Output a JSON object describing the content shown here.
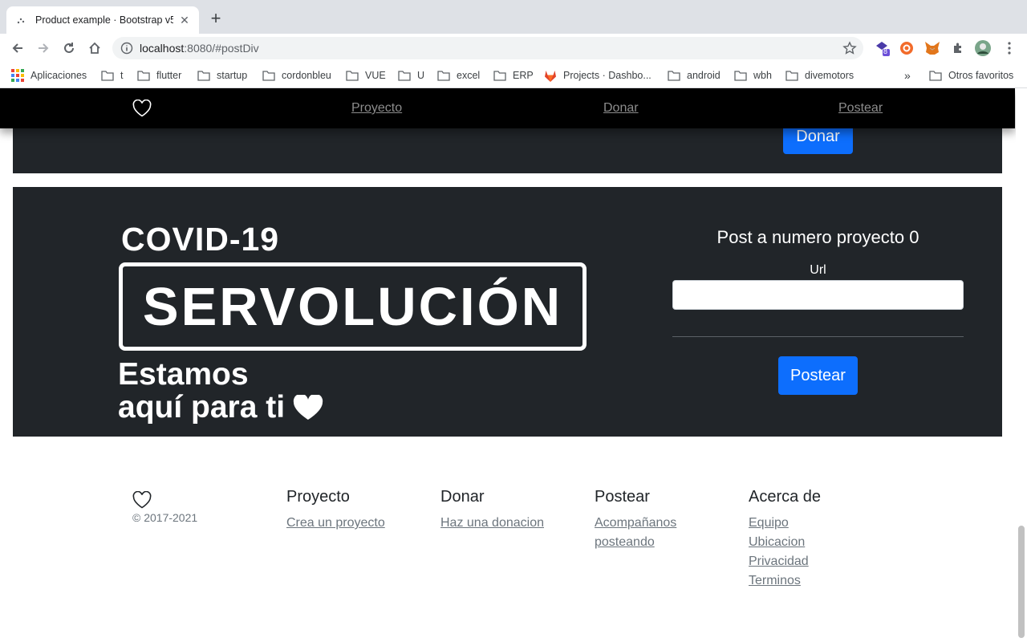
{
  "browser": {
    "tab_title": "Product example · Bootstrap v5",
    "url_host": "localhost",
    "url_rest": ":8080/#postDiv",
    "extension_badge": "8",
    "bookmarks": [
      "Aplicaciones",
      "t",
      "flutter",
      "startup",
      "cordonbleu",
      "VUE",
      "U",
      "excel",
      "ERP",
      "Projects · Dashbo...",
      "android",
      "wbh",
      "divemotors"
    ],
    "bookmarks_overflow": "»",
    "other_favorites": "Otros favoritos"
  },
  "nav": {
    "links": [
      "Proyecto",
      "Donar",
      "Postear"
    ]
  },
  "prev_section": {
    "donate_button": "Donar"
  },
  "banner": {
    "line1": "COVID-19",
    "box_text": "SERVOLUCIÓN",
    "line3": "Estamos",
    "line4": "aquí para ti"
  },
  "post_form": {
    "title": "Post a numero proyecto 0",
    "url_label": "Url",
    "url_value": "",
    "submit": "Postear"
  },
  "footer": {
    "copyright": "© 2017-2021",
    "columns": [
      {
        "title": "Proyecto",
        "links": [
          "Crea un proyecto"
        ]
      },
      {
        "title": "Donar",
        "links": [
          "Haz una donacion"
        ]
      },
      {
        "title": "Postear",
        "links": [
          "Acompañanos",
          "posteando"
        ]
      },
      {
        "title": "Acerca de",
        "links": [
          "Equipo",
          "Ubicacion",
          "Privacidad",
          "Terminos"
        ]
      }
    ]
  },
  "colors": {
    "primary": "#0d6efd",
    "dark_section": "#212529",
    "navbar": "#000000"
  }
}
